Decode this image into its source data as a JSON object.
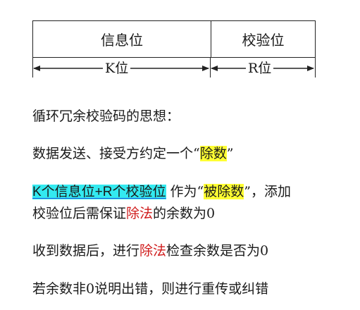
{
  "diagram": {
    "info_cell": "信息位",
    "check_cell": "校验位",
    "k_label": "K位",
    "r_label": "R位"
  },
  "text": {
    "line1": "循环冗余校验码的思想：",
    "line2_pre": "数据发送、接受方约定一个“",
    "line2_hl": "除数",
    "line2_post": "”",
    "line3_hl": "K个信息位+R个校验位",
    "line3_mid": " 作为“",
    "line3_hl2": "被除数",
    "line3_post": "”，添加",
    "line4_pre": "校验位后需保证",
    "line4_red": "除法",
    "line4_post": "的余数为0",
    "line5_pre": "收到数据后，进行",
    "line5_red": "除法",
    "line5_post": "检查余数是否为0",
    "line6": "若余数非0说明出错，则进行重传或纠错"
  },
  "colors": {
    "highlight_yellow": "#ffff33",
    "highlight_cyan": "#33eaf0",
    "red_text": "#d01c1c",
    "underline_blue": "#2255dd"
  }
}
